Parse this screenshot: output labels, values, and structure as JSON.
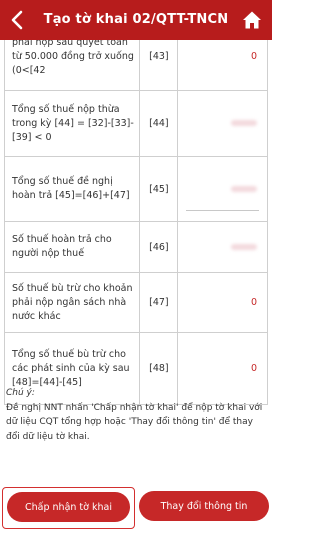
{
  "header": {
    "title": "Tạo tờ khai 02/QTT-TNCN",
    "back_icon": "chevron-left-icon",
    "home_icon": "home-icon",
    "bg_color": "#b71c1c"
  },
  "rows": [
    {
      "desc": "phải nộp sau quyết toán từ 50.000 đồng trở xuống (0<[42",
      "code": "[43]",
      "value": "0"
    },
    {
      "desc": "Tổng số thuế nộp thừa trong kỳ [44] = [32]-[33]-[39] < 0",
      "code": "[44]",
      "value": ""
    },
    {
      "desc": "Tổng số thuế đề nghị hoàn trả [45]=[46]+[47]",
      "code": "[45]",
      "value": ""
    },
    {
      "desc": "Số thuế hoàn trả cho người nộp thuế",
      "code": "[46]",
      "value": ""
    },
    {
      "desc": "Số thuế bù trừ cho khoản phải nộp ngân sách nhà nước khác",
      "code": "[47]",
      "value": "0"
    },
    {
      "desc": "Tổng số thuế bù trừ cho các phát sinh của kỳ sau [48]=[44]-[45]",
      "code": "[48]",
      "value": "0"
    }
  ],
  "note": {
    "title": "Chú ý:",
    "text": "Đề nghị NNT nhấn 'Chấp nhận tờ khai' để nộp tờ khai với dữ liệu CQT tổng hợp hoặc 'Thay đổi thông tin' để thay đổi dữ liệu tờ khai."
  },
  "buttons": {
    "accept": "Chấp nhận tờ khai",
    "change": "Thay đổi thông tin"
  },
  "colors": {
    "accent": "#c62828",
    "value_red": "#c62828"
  }
}
